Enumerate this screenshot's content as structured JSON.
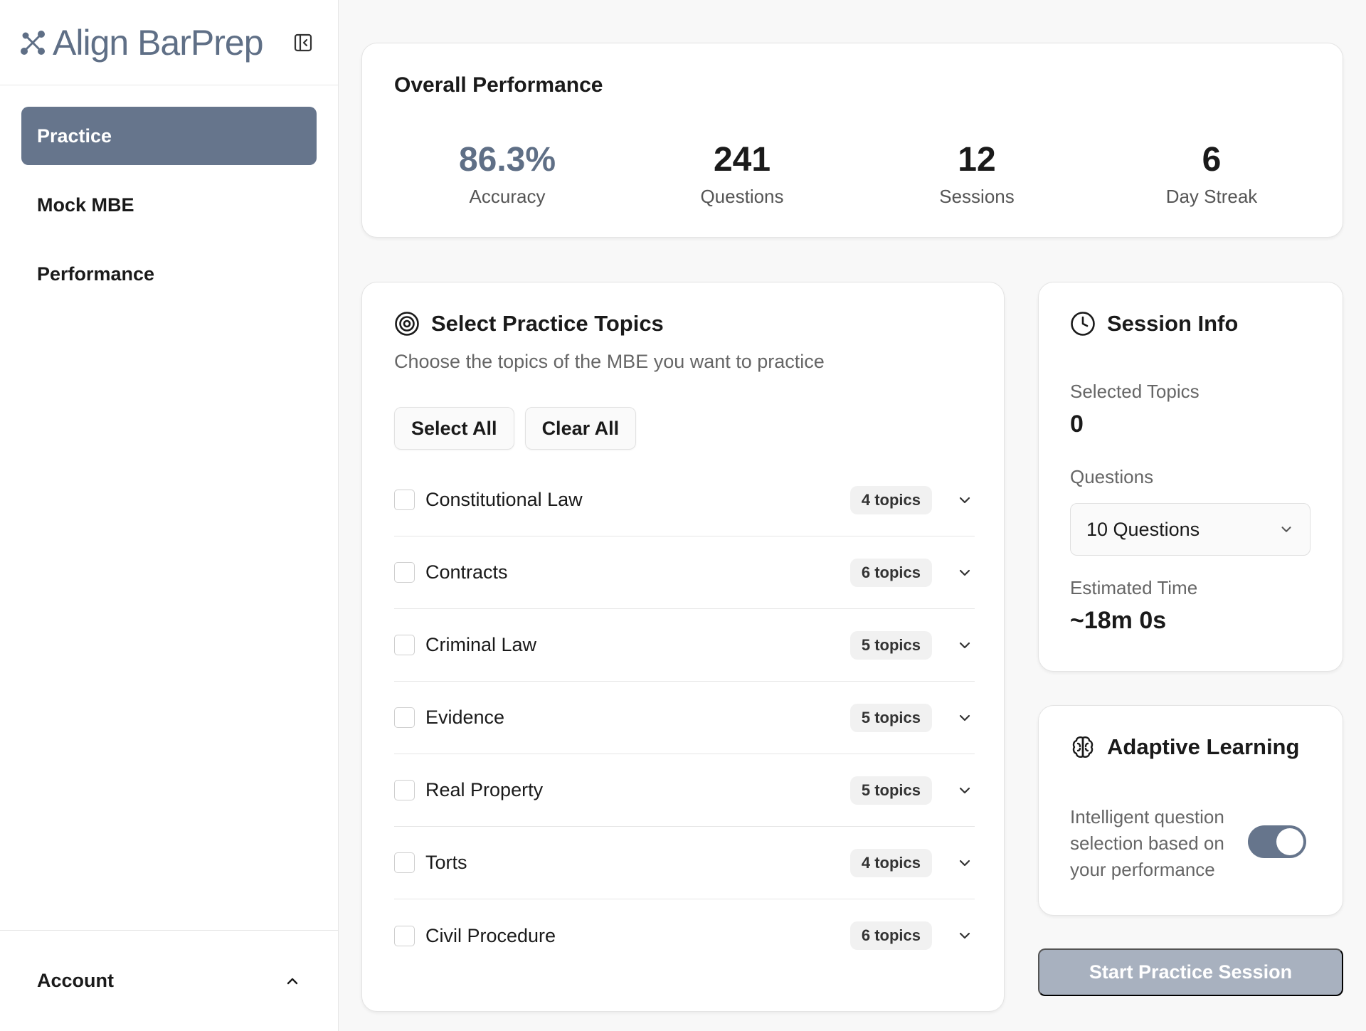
{
  "brand": {
    "name": "Align BarPrep"
  },
  "sidebar": {
    "items": [
      {
        "label": "Practice",
        "active": true
      },
      {
        "label": "Mock MBE",
        "active": false
      },
      {
        "label": "Performance",
        "active": false
      }
    ],
    "account_label": "Account"
  },
  "overall": {
    "title": "Overall Performance",
    "stats": [
      {
        "value": "86.3%",
        "label": "Accuracy"
      },
      {
        "value": "241",
        "label": "Questions"
      },
      {
        "value": "12",
        "label": "Sessions"
      },
      {
        "value": "6",
        "label": "Day Streak"
      }
    ]
  },
  "topics": {
    "title": "Select Practice Topics",
    "subtitle": "Choose the topics of the MBE you want to practice",
    "select_all": "Select All",
    "clear_all": "Clear All",
    "items": [
      {
        "name": "Constitutional Law",
        "count": "4 topics"
      },
      {
        "name": "Contracts",
        "count": "6 topics"
      },
      {
        "name": "Criminal Law",
        "count": "5 topics"
      },
      {
        "name": "Evidence",
        "count": "5 topics"
      },
      {
        "name": "Real Property",
        "count": "5 topics"
      },
      {
        "name": "Torts",
        "count": "4 topics"
      },
      {
        "name": "Civil Procedure",
        "count": "6 topics"
      }
    ]
  },
  "session": {
    "title": "Session Info",
    "selected_label": "Selected Topics",
    "selected_value": "0",
    "questions_label": "Questions",
    "questions_selected": "10 Questions",
    "time_label": "Estimated Time",
    "time_value": "~18m 0s"
  },
  "adaptive": {
    "title": "Adaptive Learning",
    "description": "Intelligent question selection based on your performance",
    "enabled": true
  },
  "start_label": "Start Practice Session",
  "colors": {
    "accent": "#66758c",
    "brand_text": "#5f6f86",
    "disabled_button": "#a8b1bf"
  }
}
